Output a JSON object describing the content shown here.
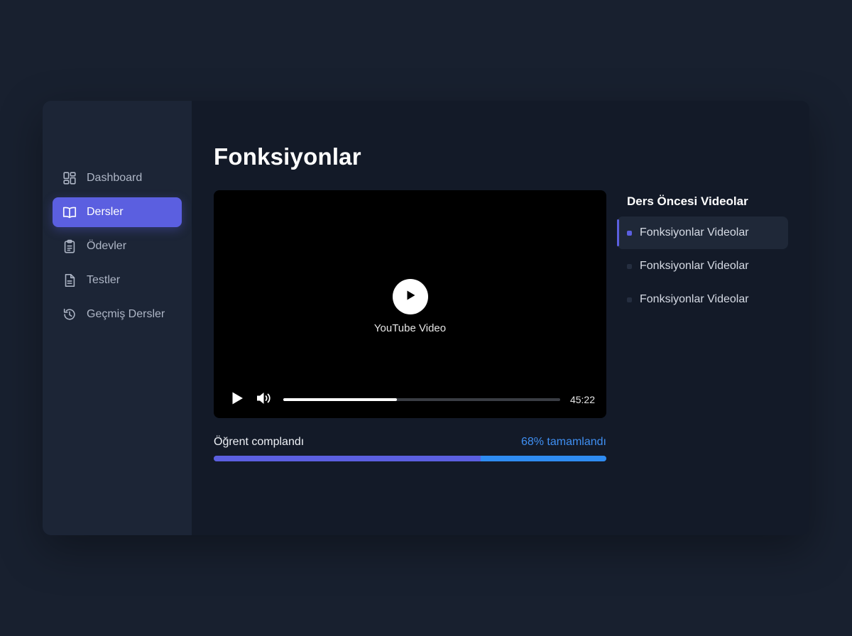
{
  "sidebar": {
    "items": [
      {
        "label": "Dashboard",
        "icon": "dashboard-icon",
        "active": false
      },
      {
        "label": "Dersler",
        "icon": "book-icon",
        "active": true
      },
      {
        "label": "Ödevler",
        "icon": "clipboard-icon",
        "active": false
      },
      {
        "label": "Testler",
        "icon": "document-icon",
        "active": false
      },
      {
        "label": "Geçmiş Dersler",
        "icon": "history-icon",
        "active": false
      }
    ]
  },
  "main": {
    "title": "Fonksiyonlar",
    "video": {
      "label": "YouTube Video",
      "time": "45:22",
      "progress": 0.41
    },
    "progress": {
      "label": "Öğrent complandı",
      "percent_text": "68% tamamlandı",
      "value": 68
    }
  },
  "pre_videos": {
    "title": "Ders Öncesi Videolar",
    "items": [
      {
        "label": "Fonksiyonlar Videolar",
        "active": true
      },
      {
        "label": "Fonksiyonlar Videolar",
        "active": false
      },
      {
        "label": "Fonksiyonlar Videolar",
        "active": false
      }
    ]
  },
  "colors": {
    "accent": "#5b5fe0",
    "progress_blue": "#2f8cf2",
    "percent_text": "#3f8ff2"
  }
}
